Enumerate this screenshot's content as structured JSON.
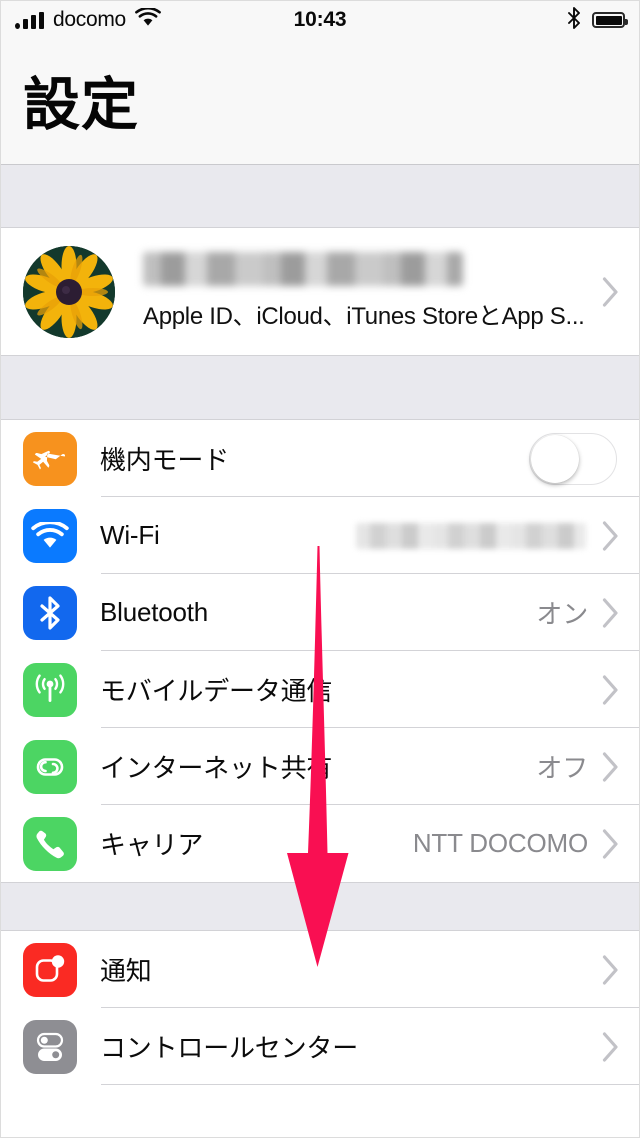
{
  "status_bar": {
    "carrier": "docomo",
    "time": "10:43",
    "signal_icon": "signal-bars-icon",
    "wifi_icon": "wifi-icon",
    "bluetooth_icon": "bluetooth-icon",
    "battery_icon": "battery-full-icon"
  },
  "nav": {
    "title": "設定"
  },
  "apple_id": {
    "avatar_icon": "sunflower-avatar",
    "name": "",
    "subtitle": "Apple ID、iCloud、iTunes StoreとApp S...",
    "chevron_icon": "chevron-right-icon"
  },
  "groups": [
    {
      "rows": [
        {
          "id": "airplane-mode",
          "icon": "airplane-icon",
          "icon_color": "#F7921E",
          "label": "機内モード",
          "control": "toggle",
          "toggle_on": false,
          "value": ""
        },
        {
          "id": "wifi",
          "icon": "wifi-icon",
          "icon_color": "#0A7AFF",
          "label": "Wi-Fi",
          "control": "chevron",
          "value": "",
          "value_redacted": true
        },
        {
          "id": "bluetooth",
          "icon": "bluetooth-icon",
          "icon_color": "#1268EE",
          "label": "Bluetooth",
          "control": "chevron",
          "value": "オン"
        },
        {
          "id": "cellular",
          "icon": "cellular-antenna-icon",
          "icon_color": "#4CD563",
          "label": "モバイルデータ通信",
          "control": "chevron",
          "value": ""
        },
        {
          "id": "personal-hotspot",
          "icon": "personal-hotspot-icon",
          "icon_color": "#4CD563",
          "label": "インターネット共有",
          "control": "chevron",
          "value": "オフ"
        },
        {
          "id": "carrier",
          "icon": "phone-icon",
          "icon_color": "#4CD563",
          "label": "キャリア",
          "control": "chevron",
          "value": "NTT DOCOMO"
        }
      ]
    },
    {
      "rows": [
        {
          "id": "notifications",
          "icon": "notifications-icon",
          "icon_color": "#FA2A23",
          "label": "通知",
          "control": "chevron",
          "value": ""
        },
        {
          "id": "control-center",
          "icon": "control-center-icon",
          "icon_color": "#8E8E93",
          "label": "コントロールセンター",
          "control": "chevron",
          "value": ""
        }
      ]
    }
  ],
  "annotation": {
    "arrow_icon": "down-arrow-annotation",
    "arrow_color": "#F90F52",
    "arrow_direction": "down"
  }
}
